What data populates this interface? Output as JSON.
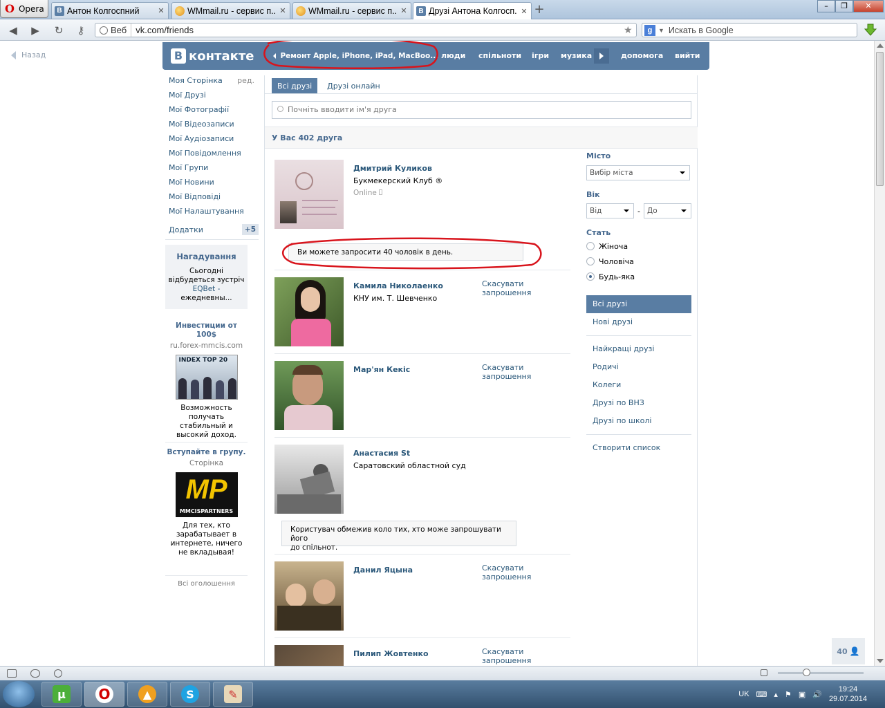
{
  "browser": {
    "menu_label": "Opera",
    "tabs": [
      {
        "title": "Антон Колгоспний",
        "icon": "vk-favicon",
        "active": false
      },
      {
        "title": "WMmail.ru - сервис п...",
        "icon": "wmmail-favicon",
        "active": false
      },
      {
        "title": "WMmail.ru - сервис п...",
        "icon": "wmmail-favicon",
        "active": false
      },
      {
        "title": "Друзі Антона Колгосп...",
        "icon": "vk-favicon",
        "active": true
      }
    ],
    "address_mode": "Веб",
    "url": "vk.com/friends",
    "search_placeholder": "Искать в Google"
  },
  "page": {
    "back_label": "Назад",
    "header": {
      "logo": "контакте",
      "ad_text": "Ремонт Apple, iPhone, iPad, MacBoo...",
      "nav": [
        "люди",
        "спільноти",
        "ігри",
        "музика",
        "допомога",
        "вийти"
      ]
    },
    "left_menu": {
      "items": [
        "Моя Сторінка",
        "Мої Друзі",
        "Мої Фотографії",
        "Мої Відеозаписи",
        "Мої Аудіозаписи",
        "Мої Повідомлення",
        "Мої Групи",
        "Мої Новини",
        "Мої Відповіді",
        "Мої Налаштування"
      ],
      "edit_label": "ред.",
      "addons_label": "Додатки",
      "addons_count": "+5"
    },
    "reminder": {
      "title": "Нагадування",
      "line1": "Сьогодні",
      "line2": "відбудеться зустріч",
      "link": "EQBet -",
      "line4": "ежедневны..."
    },
    "ads": [
      {
        "title": "Инвестиции от 100$",
        "domain": "ru.forex-mmcis.com",
        "image_text": "INDEX TOP 20",
        "text": "Возможность получать стабильный и высокий доход."
      },
      {
        "title": "Вступайте в групу.",
        "domain": "Сторінка",
        "image_text": "MP",
        "image_sub": "MMCISPARTNERS",
        "text": "Для тех, кто зарабатывает в интернете, ничего не вкладывая!"
      }
    ],
    "all_ads_label": "Всі оголошення",
    "main": {
      "tabs": [
        "Всі друзі",
        "Друзі онлайн"
      ],
      "search_placeholder": "Почніть вводити ім'я друга",
      "count_label": "У Вас 402 друга",
      "cancel_label": "Скасувати запрошення",
      "friends": [
        {
          "name": "Дмитрий Куликов",
          "sub": "Букмекерский Клуб ®",
          "status": "Online"
        },
        {
          "name": "Камила Николаенко",
          "sub": "КНУ им. Т. Шевченко",
          "status": ""
        },
        {
          "name": "Мар'ян Кекіс",
          "sub": "",
          "status": ""
        },
        {
          "name": "Анастасия St",
          "sub": "Саратовский областной суд",
          "status": ""
        },
        {
          "name": "Данил Яцына",
          "sub": "",
          "status": ""
        },
        {
          "name": "Пилип Жовтенко",
          "sub": "",
          "status": ""
        }
      ],
      "notice_limit": "Ви можете запросити 40 чоловік в день.",
      "notice_restricted_line1": "Користувач обмежив коло тих, хто може запрошувати його",
      "notice_restricted_line2": "до спільнот."
    },
    "filters": {
      "city_label": "Місто",
      "city_value": "Вибір міста",
      "age_label": "Вік",
      "age_from": "Від",
      "age_dash": "-",
      "age_to": "До",
      "gender_label": "Стать",
      "genders": [
        "Жіноча",
        "Чоловіча",
        "Будь-яка"
      ],
      "selected_gender": "Будь-яка",
      "lists_primary": [
        "Всі друзі",
        "Нові друзі"
      ],
      "lists_secondary": [
        "Найкращі друзі",
        "Родичі",
        "Колеги",
        "Друзі по ВНЗ",
        "Друзі по школі"
      ],
      "create_list": "Створити список"
    },
    "invites_badge": "40"
  },
  "taskbar": {
    "lang": "UK",
    "time": "19:24",
    "date": "29.07.2014"
  },
  "colors": {
    "vk_header": "#597da3",
    "link": "#2b587a",
    "annotation_red": "#d8141c"
  }
}
